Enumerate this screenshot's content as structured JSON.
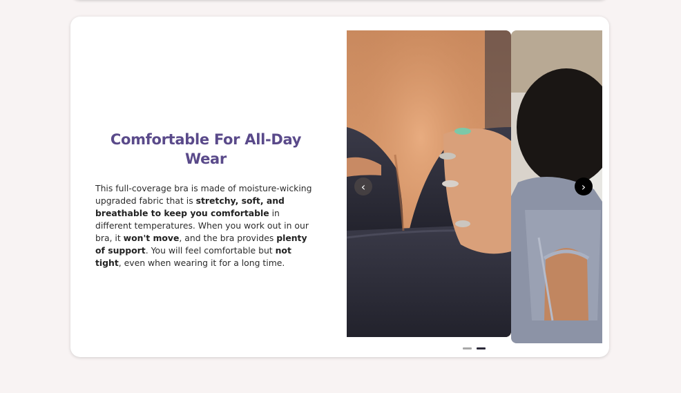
{
  "section": {
    "heading": "Comfortable For All-Day Wear",
    "paragraph": [
      {
        "text": "This full-coverage bra is made of moisture-wicking upgraded fabric that is ",
        "bold": false
      },
      {
        "text": "stretchy, soft, and breathable to keep you comfortable",
        "bold": true
      },
      {
        "text": " in different temperatures. When you work out in our bra, it ",
        "bold": false
      },
      {
        "text": "won't move",
        "bold": true
      },
      {
        "text": ", and the bra provides ",
        "bold": false
      },
      {
        "text": "plenty of support",
        "bold": true
      },
      {
        "text": ". You will feel comfortable but ",
        "bold": false
      },
      {
        "text": "not tight",
        "bold": true
      },
      {
        "text": ", even when wearing it for a long time.",
        "bold": false
      }
    ]
  },
  "carousel": {
    "prev_icon": "chevron-left-icon",
    "next_icon": "chevron-right-icon",
    "prev_glyph": "‹",
    "next_glyph": "›",
    "dot_count": 2,
    "active_index": 1,
    "colors": {
      "heading": "#5a4a8a",
      "active_dot": "#2a2838",
      "inactive_dot": "#a8a8a8"
    }
  }
}
